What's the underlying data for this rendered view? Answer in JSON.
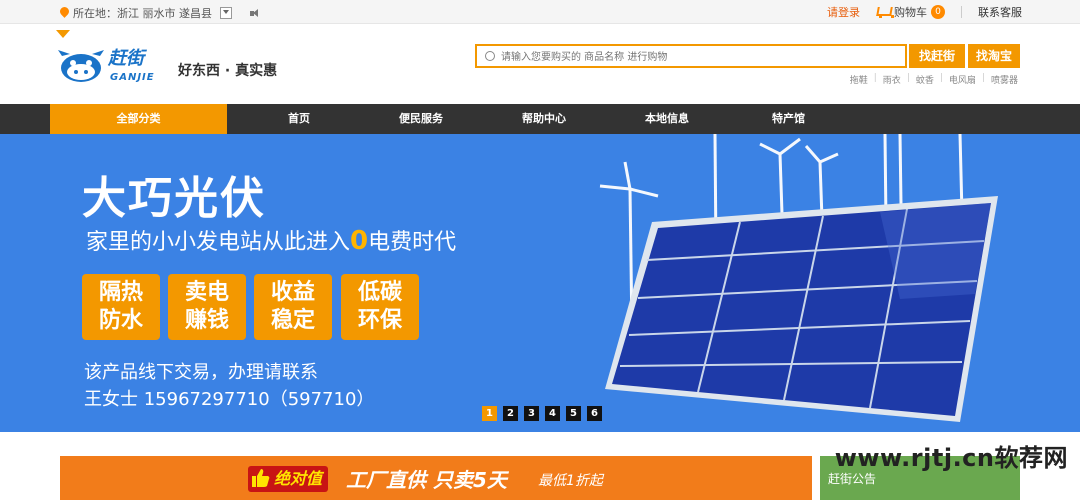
{
  "topbar": {
    "location_label": "所在地：浙江 丽水市 遂昌县",
    "login": "请登录",
    "cart_label": "购物车",
    "cart_count": "0",
    "service": "联系客服"
  },
  "header": {
    "logo_text": "赶街",
    "logo_sub": "GANJIE",
    "slogan": "好东西 · 真实惠",
    "search_placeholder": "请输入您要购买的 商品名称 进行购物",
    "btn_ganjie": "找赶街",
    "btn_taobao": "找淘宝",
    "hot_words": [
      "拖鞋",
      "雨衣",
      "蚊香",
      "电风扇",
      "喷雾器"
    ]
  },
  "nav": {
    "all": "全部分类",
    "items": [
      "首页",
      "便民服务",
      "帮助中心",
      "本地信息",
      "特产馆"
    ]
  },
  "banner": {
    "title": "大巧光伏",
    "sub_before": "家里的小小发电站从此进入",
    "sub_zero": "0",
    "sub_after": "电费时代",
    "features": [
      {
        "line1": "隔热",
        "line2": "防水"
      },
      {
        "line1": "卖电",
        "line2": "赚钱"
      },
      {
        "line1": "收益",
        "line2": "稳定"
      },
      {
        "line1": "低碳",
        "line2": "环保"
      }
    ],
    "contact1": "该产品线下交易，办理请联系",
    "contact2": "王女士  15967297710（597710）",
    "slides": [
      "1",
      "2",
      "3",
      "4",
      "5",
      "6"
    ],
    "active_slide": 1
  },
  "promo": {
    "badge": "绝对值",
    "text": "工厂直供  只卖5天",
    "small": "最低1折起"
  },
  "notice": {
    "title": "赶街公告"
  },
  "watermark": "www.rjtj.cn软荐网",
  "colors": {
    "accent": "#f39800",
    "nav_bg": "#333333",
    "banner_bg": "#3b82e4",
    "brand": "#1a73c8"
  }
}
